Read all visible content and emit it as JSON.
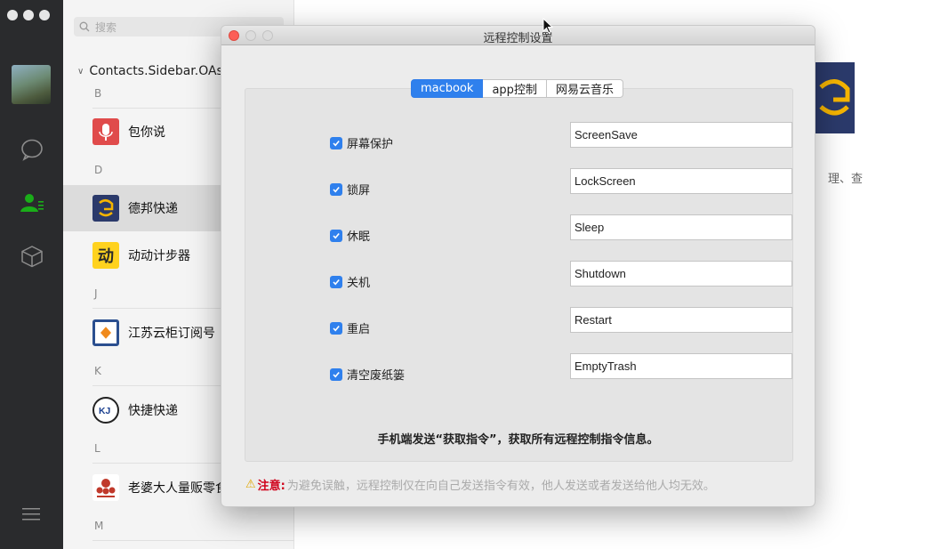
{
  "contacts": {
    "search_placeholder": "搜索",
    "group_title": "Contacts.Sidebar.OAs",
    "sections": [
      {
        "letter": "B",
        "items": [
          {
            "name": "包你说",
            "icon": "microphone-icon"
          }
        ]
      },
      {
        "letter": "D",
        "items": [
          {
            "name": "德邦快递",
            "icon": "deppon-logo",
            "selected": true
          },
          {
            "name": "动动计步器",
            "icon": "dong-logo"
          }
        ]
      },
      {
        "letter": "J",
        "items": [
          {
            "name": "江苏云柜订阅号",
            "icon": "cloud-cabinet-logo"
          }
        ]
      },
      {
        "letter": "K",
        "items": [
          {
            "name": "快捷快递",
            "icon": "kj-logo"
          }
        ]
      },
      {
        "letter": "L",
        "items": [
          {
            "name": "老婆大人量贩零食",
            "icon": "laopo-logo"
          }
        ]
      },
      {
        "letter": "M",
        "items": []
      }
    ]
  },
  "detail": {
    "text_fragment": "理、查"
  },
  "dialog": {
    "title": "远程控制设置",
    "tabs": [
      {
        "label": "macbook",
        "active": true
      },
      {
        "label": "app控制",
        "active": false
      },
      {
        "label": "网易云音乐",
        "active": false
      }
    ],
    "commands": [
      {
        "label": "屏幕保护",
        "value": "ScreenSave",
        "checked": true
      },
      {
        "label": "锁屏",
        "value": "LockScreen",
        "checked": true
      },
      {
        "label": "休眠",
        "value": "Sleep",
        "checked": true
      },
      {
        "label": "关机",
        "value": "Shutdown",
        "checked": true
      },
      {
        "label": "重启",
        "value": "Restart",
        "checked": true
      },
      {
        "label": "清空废纸篓",
        "value": "EmptyTrash",
        "checked": true
      }
    ],
    "hint": "手机端发送“获取指令”，获取所有远程控制指令信息。",
    "notice_label": "注意:",
    "notice_text": "为避免误触，远程控制仅在向自己发送指令有效，他人发送或者发送给他人均无效。"
  },
  "colors": {
    "accent": "#2f80ed",
    "rail": "#2a2b2d",
    "selected_row": "#dcdcdc",
    "warning": "#d0021b"
  }
}
